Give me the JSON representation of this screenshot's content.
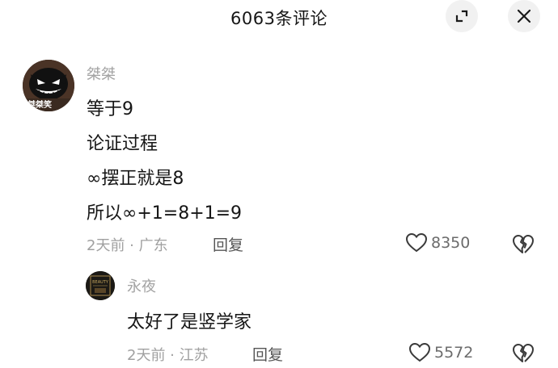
{
  "header": {
    "title": "6063条评论",
    "expand_icon": "expand-icon",
    "close_icon": "close-icon"
  },
  "comment": {
    "username": "桀桀",
    "avatar_text": "桀桀笑",
    "lines": [
      "等于9",
      "论证过程",
      "∞摆正就是8",
      "所以∞+1=8+1=9"
    ],
    "time": "2天前",
    "location": "广东",
    "reply_label": "回复",
    "likes": "8350"
  },
  "reply": {
    "username": "永夜",
    "text": "太好了是竖学家",
    "time": "2天前",
    "location": "江苏",
    "reply_label": "回复",
    "likes": "5572"
  }
}
